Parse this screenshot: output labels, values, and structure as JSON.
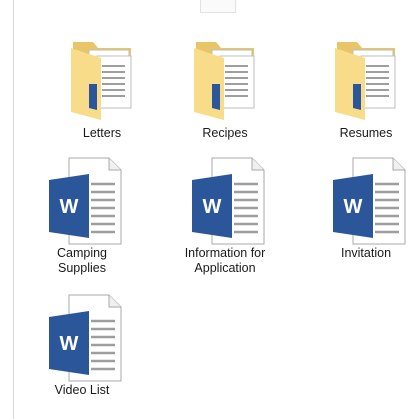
{
  "folder_view": {
    "items": [
      {
        "label": "Letters",
        "type": "folder",
        "icon": "folder-with-documents-icon"
      },
      {
        "label": "Recipes",
        "type": "folder",
        "icon": "folder-with-documents-icon"
      },
      {
        "label": "Resumes",
        "type": "folder",
        "icon": "folder-with-documents-icon"
      },
      {
        "label": "Camping\nSupplies",
        "type": "document",
        "icon": "word-document-icon"
      },
      {
        "label": "Information for\nApplication",
        "type": "document",
        "icon": "word-document-icon"
      },
      {
        "label": "Invitation",
        "type": "document",
        "icon": "word-document-icon"
      },
      {
        "label": "Video List",
        "type": "document",
        "icon": "word-document-icon"
      }
    ]
  },
  "colors": {
    "folder_back": "#e7c568",
    "folder_front": "#f8dc8a",
    "word_blue": "#2b579a",
    "page_lines": "#9e9e9e"
  },
  "icon_letter": "W"
}
